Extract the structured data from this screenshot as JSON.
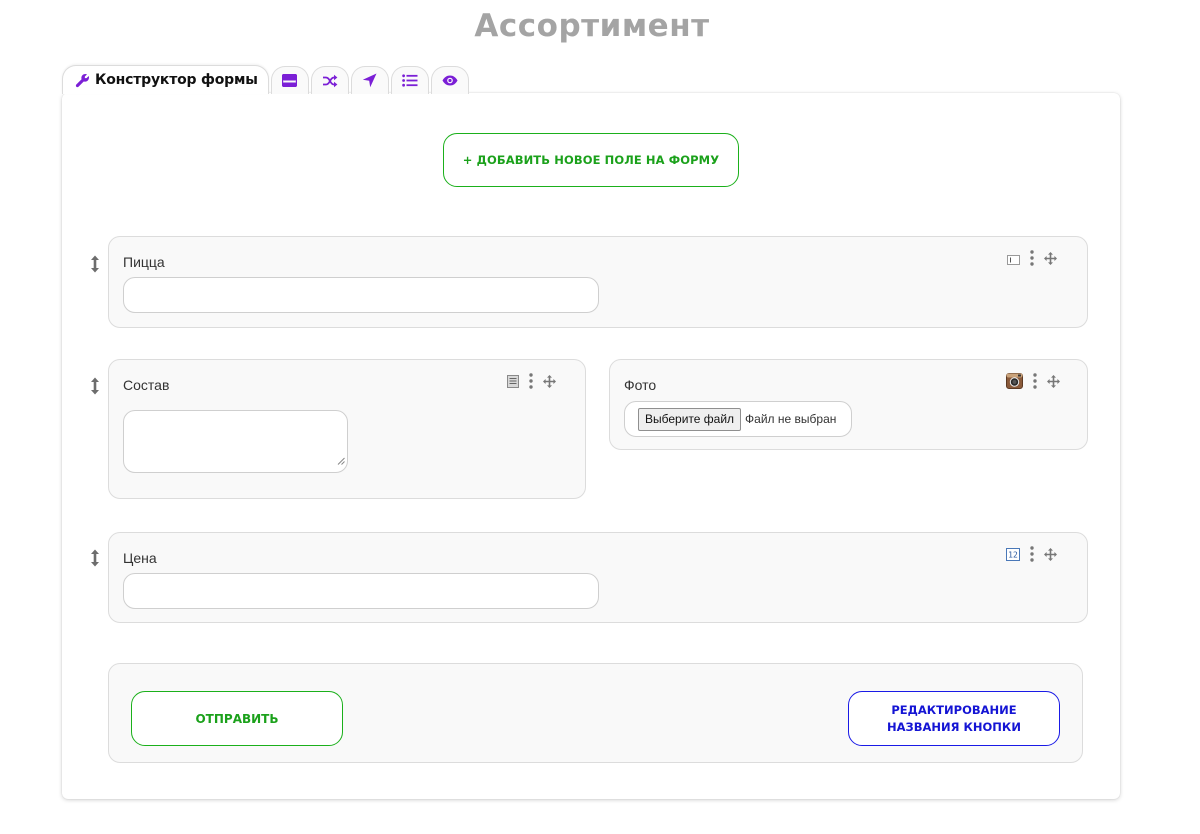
{
  "page": {
    "title": "Ассортимент"
  },
  "tabs": [
    {
      "label": "Конструктор формы",
      "icon": "wrench-icon",
      "active": true
    },
    {
      "label": "",
      "icon": "window-icon",
      "active": false
    },
    {
      "label": "",
      "icon": "shuffle-icon",
      "active": false
    },
    {
      "label": "",
      "icon": "location-arrow-icon",
      "active": false
    },
    {
      "label": "",
      "icon": "list-icon",
      "active": false
    },
    {
      "label": "",
      "icon": "eye-icon",
      "active": false
    }
  ],
  "builder": {
    "add_field_label": "+ ДОБАВИТЬ НОВОЕ ПОЛЕ НА ФОРМУ"
  },
  "fields": {
    "pizza": {
      "label": "Пицца",
      "type_icon": "text-field-icon",
      "value": ""
    },
    "composition": {
      "label": "Состав",
      "type_icon": "textarea-icon",
      "value": ""
    },
    "photo": {
      "label": "Фото",
      "type_icon": "camera-icon",
      "choose_button": "Выберите файл",
      "status": "Файл не выбран"
    },
    "price": {
      "label": "Цена",
      "type_icon": "number-field-icon",
      "value": ""
    }
  },
  "form_buttons": {
    "submit_label": "ОТПРАВИТЬ",
    "edit_name_label": "РЕДАКТИРОВАНИЕ НАЗВАНИЯ КНОПКИ"
  },
  "colors": {
    "accent_purple": "#7b1fd6",
    "submit_green": "#1ba11b",
    "edit_blue": "#1414d4",
    "title_gray": "#a4a4a4"
  }
}
